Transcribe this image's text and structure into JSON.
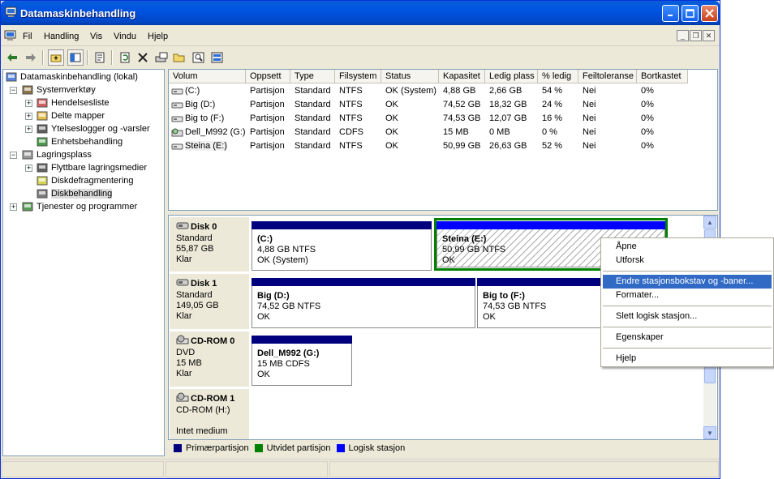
{
  "window": {
    "title": "Datamaskinbehandling"
  },
  "menu": [
    "Fil",
    "Handling",
    "Vis",
    "Vindu",
    "Hjelp"
  ],
  "toolbar": [
    "back-icon",
    "forward-icon",
    "up-folder-icon",
    "show-hide-tree-icon",
    "properties-icon",
    "refresh-icon",
    "delete-icon",
    "disk-properties-icon",
    "open-folder-icon",
    "search-icon",
    "help-topics-icon"
  ],
  "tree": [
    {
      "label": "Datamaskinbehandling (lokal)",
      "level": 0,
      "expander": ""
    },
    {
      "label": "Systemverktøy",
      "level": 1,
      "expander": "−"
    },
    {
      "label": "Hendelsesliste",
      "level": 2,
      "expander": "+"
    },
    {
      "label": "Delte mapper",
      "level": 2,
      "expander": "+"
    },
    {
      "label": "Ytelseslogger og -varsler",
      "level": 2,
      "expander": "+"
    },
    {
      "label": "Enhetsbehandling",
      "level": 2,
      "expander": ""
    },
    {
      "label": "Lagringsplass",
      "level": 1,
      "expander": "−"
    },
    {
      "label": "Flyttbare lagringsmedier",
      "level": 2,
      "expander": "+"
    },
    {
      "label": "Diskdefragmentering",
      "level": 2,
      "expander": ""
    },
    {
      "label": "Diskbehandling",
      "level": 2,
      "expander": "",
      "selected": true
    },
    {
      "label": "Tjenester og programmer",
      "level": 1,
      "expander": "+"
    }
  ],
  "volume_list": {
    "columns": [
      "Volum",
      "Oppsett",
      "Type",
      "Filsystem",
      "Status",
      "Kapasitet",
      "Ledig plass",
      "% ledig",
      "Feiltoleranse",
      "Bortkastet"
    ],
    "rows": [
      [
        "(C:)",
        "Partisjon",
        "Standard",
        "NTFS",
        "OK (System)",
        "4,88 GB",
        "2,66 GB",
        "54 %",
        "Nei",
        "0%"
      ],
      [
        "Big (D:)",
        "Partisjon",
        "Standard",
        "NTFS",
        "OK",
        "74,52 GB",
        "18,32 GB",
        "24 %",
        "Nei",
        "0%"
      ],
      [
        "Big to (F:)",
        "Partisjon",
        "Standard",
        "NTFS",
        "OK",
        "74,53 GB",
        "12,07 GB",
        "16 %",
        "Nei",
        "0%"
      ],
      [
        "Dell_M992 (G:)",
        "Partisjon",
        "Standard",
        "CDFS",
        "OK",
        "15 MB",
        "0 MB",
        "0 %",
        "Nei",
        "0%"
      ],
      [
        "Steina (E:)",
        "Partisjon",
        "Standard",
        "NTFS",
        "OK",
        "50,99 GB",
        "26,63 GB",
        "52 %",
        "Nei",
        "0%"
      ]
    ]
  },
  "disks": [
    {
      "name": "Disk 0",
      "line1": "Standard",
      "line2": "55,87 GB",
      "line3": "Klar",
      "parts": [
        {
          "label": "(C:)",
          "size": "4,88 GB NTFS",
          "status": "OK (System)",
          "kind": "primary"
        },
        {
          "label": "Steina  (E:)",
          "size": "50,99 GB NTFS",
          "status": "OK",
          "kind": "logical"
        }
      ]
    },
    {
      "name": "Disk 1",
      "line1": "Standard",
      "line2": "149,05 GB",
      "line3": "Klar",
      "parts": [
        {
          "label": "Big  (D:)",
          "size": "74,52 GB NTFS",
          "status": "OK",
          "kind": "primary"
        },
        {
          "label": "Big to  (F:)",
          "size": "74,53 GB NTFS",
          "status": "OK",
          "kind": "primary"
        }
      ]
    },
    {
      "name": "CD-ROM 0",
      "line1": "DVD",
      "line2": "15 MB",
      "line3": "Klar",
      "parts": [
        {
          "label": "Dell_M992  (G:)",
          "size": "15 MB CDFS",
          "status": "OK",
          "kind": "primary"
        }
      ]
    },
    {
      "name": "CD-ROM 1",
      "line1": "CD-ROM (H:)",
      "line2": "",
      "line3": "Intet medium",
      "parts": []
    }
  ],
  "legend": [
    {
      "label": "Primærpartisjon",
      "color": "#00007f"
    },
    {
      "label": "Utvidet partisjon",
      "color": "#008000"
    },
    {
      "label": "Logisk stasjon",
      "color": "#0000ff"
    }
  ],
  "context_menu": [
    {
      "label": "Åpne"
    },
    {
      "label": "Utforsk"
    },
    {
      "sep": true
    },
    {
      "label": "Endre stasjonsbokstav og -baner...",
      "highlighted": true
    },
    {
      "label": "Formater..."
    },
    {
      "sep": true
    },
    {
      "label": "Slett logisk stasjon..."
    },
    {
      "sep": true
    },
    {
      "label": "Egenskaper"
    },
    {
      "sep": true
    },
    {
      "label": "Hjelp"
    }
  ]
}
